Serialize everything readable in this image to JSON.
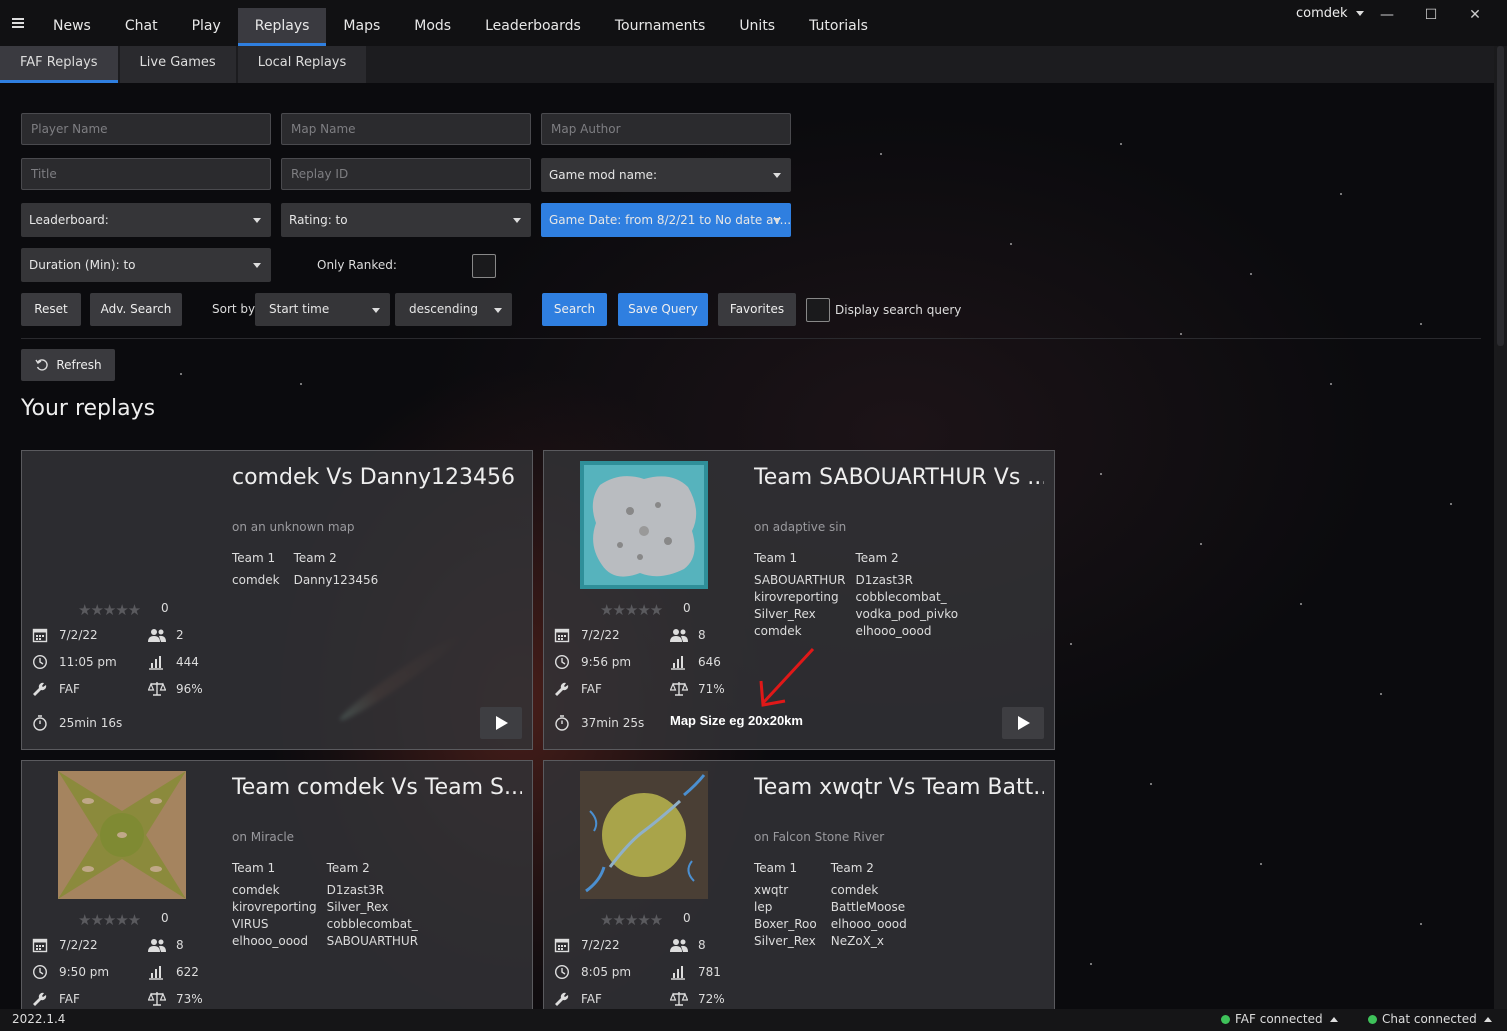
{
  "nav": {
    "tabs": [
      "News",
      "Chat",
      "Play",
      "Replays",
      "Maps",
      "Mods",
      "Leaderboards",
      "Tournaments",
      "Units",
      "Tutorials"
    ],
    "active": "Replays",
    "user": "comdek"
  },
  "window": {
    "minimize": "—",
    "maximize": "☐",
    "close": "✕"
  },
  "subtabs": [
    "FAF Replays",
    "Live Games",
    "Local Replays"
  ],
  "search": {
    "player_name_placeholder": "Player Name",
    "map_name_placeholder": "Map Name",
    "map_author_placeholder": "Map Author",
    "title_placeholder": "Title",
    "replay_id_placeholder": "Replay ID",
    "game_mod": "Game mod name:",
    "leaderboard": "Leaderboard:",
    "rating": "Rating:  to",
    "game_date": "Game Date: from 8/2/21 to No date av...",
    "duration": "Duration (Min):  to",
    "only_ranked": "Only Ranked:",
    "reset": "Reset",
    "adv_search": "Adv. Search",
    "sort_by": "Sort by",
    "sort_field": "Start time",
    "sort_order": "descending",
    "search": "Search",
    "save_query": "Save Query",
    "favorites": "Favorites",
    "display_query": "Display search query"
  },
  "refresh": "Refresh",
  "heading": "Your replays",
  "annotation": "Map Size eg 20x20km",
  "replays": [
    {
      "title": "comdek Vs Danny123456",
      "map": "on an unknown map",
      "team1": [
        "comdek"
      ],
      "team2": [
        "Danny123456"
      ],
      "team1_label": "Team 1",
      "team2_label": "Team 2",
      "ratings": "0",
      "date": "7/2/22",
      "players": "2",
      "time": "11:05 pm",
      "rating": "444",
      "mod": "FAF",
      "quality": "96%",
      "duration": "25min 16s"
    },
    {
      "title": "Team SABOUARTHUR Vs ...",
      "map": "on adaptive sin",
      "team1": [
        "SABOUARTHUR",
        "kirovreporting",
        "Silver_Rex",
        "comdek"
      ],
      "team2": [
        "D1zast3R",
        "cobblecombat_",
        "vodka_pod_pivko",
        "elhooo_oood"
      ],
      "team1_label": "Team 1",
      "team2_label": "Team 2",
      "ratings": "0",
      "date": "7/2/22",
      "players": "8",
      "time": "9:56 pm",
      "rating": "646",
      "mod": "FAF",
      "quality": "71%",
      "duration": "37min 25s"
    },
    {
      "title": "Team comdek Vs Team S...",
      "map": "on Miracle",
      "team1": [
        "comdek",
        "kirovreporting",
        "VIRUS",
        "elhooo_oood"
      ],
      "team2": [
        "D1zast3R",
        "Silver_Rex",
        "cobblecombat_",
        "SABOUARTHUR"
      ],
      "team1_label": "Team 1",
      "team2_label": "Team 2",
      "ratings": "0",
      "date": "7/2/22",
      "players": "8",
      "time": "9:50 pm",
      "rating": "622",
      "mod": "FAF",
      "quality": "73%"
    },
    {
      "title": "Team xwqtr Vs Team Batt...",
      "map": "on Falcon Stone River",
      "team1": [
        "xwqtr",
        "lep",
        "Boxer_Roo",
        "Silver_Rex"
      ],
      "team2": [
        "comdek",
        "BattleMoose",
        "elhooo_oood",
        "NeZoX_x"
      ],
      "team1_label": "Team 1",
      "team2_label": "Team 2",
      "ratings": "0",
      "date": "7/2/22",
      "players": "8",
      "time": "8:05 pm",
      "rating": "781",
      "mod": "FAF",
      "quality": "72%"
    }
  ],
  "status": {
    "version": "2022.1.4",
    "faf": "FAF connected",
    "chat": "Chat connected"
  }
}
